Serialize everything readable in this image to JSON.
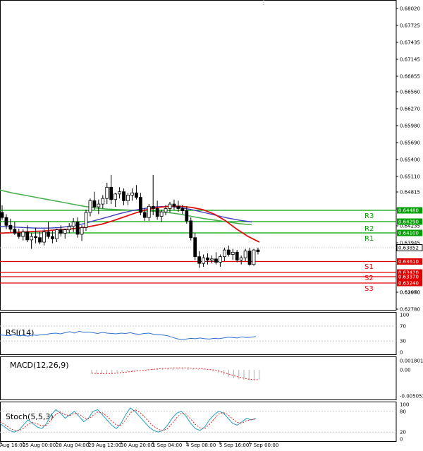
{
  "chart_data": {
    "type": "candlestick",
    "main": {
      "y_ticks": [
        "0.68020",
        "0.67725",
        "0.67435",
        "0.67145",
        "0.66855",
        "0.66560",
        "0.66270",
        "0.65980",
        "0.65690",
        "0.65400",
        "0.65110",
        "0.64815",
        "0.64525",
        "0.64235",
        "0.63945",
        "0.63610",
        "0.63250",
        "0.62960",
        "0.62780",
        "0.63070"
      ],
      "levels": [
        {
          "name": "R3",
          "value": 0.6448,
          "tag": "0.64480",
          "color": "#00a000"
        },
        {
          "name": "R2",
          "value": 0.6429,
          "tag": "0.64290",
          "color": "#00a000"
        },
        {
          "name": "R1",
          "value": 0.641,
          "tag": "0.64100",
          "color": "#00a000"
        },
        {
          "name": "S1",
          "value": 0.6342,
          "tag": "0.63420",
          "color": "#e00000"
        },
        {
          "name": "S2",
          "value": 0.6337,
          "tag": "0.63370",
          "color": "#e00000"
        },
        {
          "name": "S3",
          "value": 0.6324,
          "tag": "0.63240",
          "color": "#e00000"
        }
      ],
      "pivot": {
        "value": 0.6361,
        "tag": "0.63610",
        "color": "#e00000"
      },
      "current": {
        "value": 0.63852,
        "tag": "0.63852"
      },
      "candles": [
        [
          0.6455,
          0.6468,
          0.6442,
          0.6446
        ],
        [
          0.6446,
          0.6452,
          0.6425,
          0.6432
        ],
        [
          0.6432,
          0.6444,
          0.642,
          0.6425
        ],
        [
          0.6425,
          0.6438,
          0.6415,
          0.6418
        ],
        [
          0.6418,
          0.6426,
          0.6408,
          0.6412
        ],
        [
          0.6412,
          0.6425,
          0.6405,
          0.642
        ],
        [
          0.642,
          0.6432,
          0.6402,
          0.6406
        ],
        [
          0.6406,
          0.6418,
          0.639,
          0.6412
        ],
        [
          0.6412,
          0.6428,
          0.64,
          0.641
        ],
        [
          0.641,
          0.642,
          0.6398,
          0.6402
        ],
        [
          0.6402,
          0.6425,
          0.6396,
          0.642
        ],
        [
          0.642,
          0.6438,
          0.6408,
          0.6412
        ],
        [
          0.6412,
          0.6422,
          0.64,
          0.6408
        ],
        [
          0.6408,
          0.6426,
          0.6402,
          0.6424
        ],
        [
          0.6424,
          0.6432,
          0.6412,
          0.6418
        ],
        [
          0.6418,
          0.6426,
          0.6408,
          0.6424
        ],
        [
          0.6424,
          0.6436,
          0.6418,
          0.643
        ],
        [
          0.643,
          0.6445,
          0.642,
          0.6438
        ],
        [
          0.6438,
          0.6446,
          0.641,
          0.6416
        ],
        [
          0.6416,
          0.6432,
          0.6404,
          0.6428
        ],
        [
          0.6428,
          0.646,
          0.6422,
          0.6455
        ],
        [
          0.6455,
          0.648,
          0.6448,
          0.6476
        ],
        [
          0.6476,
          0.6492,
          0.646,
          0.6465
        ],
        [
          0.6465,
          0.6478,
          0.6452,
          0.647
        ],
        [
          0.647,
          0.6486,
          0.6462,
          0.648
        ],
        [
          0.648,
          0.6508,
          0.647,
          0.65
        ],
        [
          0.65,
          0.6522,
          0.647,
          0.6478
        ],
        [
          0.6478,
          0.649,
          0.6465,
          0.6488
        ],
        [
          0.6488,
          0.65,
          0.648,
          0.6492
        ],
        [
          0.6492,
          0.6498,
          0.6468,
          0.6476
        ],
        [
          0.6476,
          0.649,
          0.6468,
          0.6486
        ],
        [
          0.6486,
          0.6498,
          0.6476,
          0.649
        ],
        [
          0.649,
          0.6504,
          0.6478,
          0.6482
        ],
        [
          0.6482,
          0.649,
          0.645,
          0.6455
        ],
        [
          0.6455,
          0.6462,
          0.644,
          0.6446
        ],
        [
          0.6446,
          0.647,
          0.644,
          0.6466
        ],
        [
          0.6466,
          0.6522,
          0.645,
          0.6462
        ],
        [
          0.6462,
          0.6476,
          0.6442,
          0.6448
        ],
        [
          0.6448,
          0.646,
          0.6438,
          0.6456
        ],
        [
          0.6456,
          0.6468,
          0.645,
          0.6462
        ],
        [
          0.6462,
          0.6474,
          0.6455,
          0.647
        ],
        [
          0.647,
          0.6478,
          0.646,
          0.6466
        ],
        [
          0.6466,
          0.6476,
          0.6456,
          0.6462
        ],
        [
          0.6462,
          0.6468,
          0.6452,
          0.6458
        ],
        [
          0.6458,
          0.6466,
          0.6435,
          0.644
        ],
        [
          0.644,
          0.6446,
          0.6405,
          0.641
        ],
        [
          0.641,
          0.6418,
          0.637,
          0.6376
        ],
        [
          0.6376,
          0.6386,
          0.6356,
          0.6364
        ],
        [
          0.6364,
          0.638,
          0.6358,
          0.6374
        ],
        [
          0.6374,
          0.6382,
          0.6362,
          0.637
        ],
        [
          0.637,
          0.6378,
          0.6364,
          0.6372
        ],
        [
          0.6372,
          0.6384,
          0.6362,
          0.6366
        ],
        [
          0.6366,
          0.638,
          0.6358,
          0.6376
        ],
        [
          0.6376,
          0.6392,
          0.6368,
          0.6388
        ],
        [
          0.6388,
          0.6396,
          0.6376,
          0.638
        ],
        [
          0.638,
          0.639,
          0.637,
          0.6384
        ],
        [
          0.6384,
          0.6388,
          0.6366,
          0.637
        ],
        [
          0.637,
          0.6378,
          0.6362,
          0.6374
        ],
        [
          0.6374,
          0.639,
          0.6368,
          0.6386
        ],
        [
          0.6386,
          0.6392,
          0.636,
          0.6362
        ],
        [
          0.6362,
          0.639,
          0.636,
          0.6388
        ],
        [
          0.6388,
          0.6392,
          0.638,
          0.6385
        ]
      ],
      "ma_red": [
        0.6418,
        0.6419,
        0.642,
        0.6421,
        0.6422,
        0.6424,
        0.6425,
        0.6427,
        0.643,
        0.6434,
        0.644,
        0.6447,
        0.6454,
        0.646,
        0.6464,
        0.6466,
        0.6466,
        0.6464,
        0.646,
        0.6452,
        0.644,
        0.6425,
        0.6412,
        0.6402
      ],
      "ma_blue": [
        0.643,
        0.6429,
        0.6428,
        0.6427,
        0.6427,
        0.6428,
        0.6431,
        0.6435,
        0.6441,
        0.6447,
        0.6453,
        0.6458,
        0.6462,
        0.6465,
        0.6466,
        0.6464,
        0.646,
        0.6455,
        0.645,
        0.6445,
        0.6441,
        0.6438
      ],
      "ma_green": [
        0.6495,
        0.649,
        0.6486,
        0.6482,
        0.6478,
        0.6474,
        0.647,
        0.6466,
        0.6463,
        0.6461,
        0.646,
        0.6459,
        0.6458,
        0.6457,
        0.6455,
        0.6452,
        0.6448,
        0.6444,
        0.6441,
        0.6438,
        0.6435,
        0.6433
      ]
    },
    "rsi": {
      "title": "RSI(14)",
      "ticks": [
        "100",
        "70",
        "30",
        "0"
      ],
      "values": [
        46,
        45,
        44,
        47,
        44,
        45,
        43,
        46,
        45,
        47,
        48,
        50,
        51,
        49,
        52,
        55,
        51,
        56,
        53,
        54,
        52,
        50,
        53,
        51,
        50,
        49,
        51,
        50,
        52,
        49,
        48,
        50,
        51,
        48,
        47,
        46,
        44,
        40,
        36,
        34,
        35,
        37,
        36,
        38,
        36,
        35,
        37,
        36,
        38,
        40,
        39,
        38,
        41,
        39,
        40,
        42
      ]
    },
    "macd": {
      "title": "MACD(12,26,9)",
      "ticks": [
        "0.001801",
        "0.00",
        "-0.005053"
      ],
      "bars": [
        -0.0007,
        -0.0008,
        -0.0008,
        -0.0007,
        -0.0006,
        -0.0005,
        -0.0004,
        -0.0003,
        -0.0002,
        -0.0001,
        0.0,
        0.0001,
        0.0002,
        0.0003,
        0.0003,
        0.0004,
        0.0004,
        0.0004,
        0.0004,
        0.0003,
        0.0003,
        0.0002,
        0.0001,
        0.0,
        -0.0002,
        -0.0006,
        -0.001,
        -0.0013,
        -0.0016,
        -0.0018,
        -0.0019,
        -0.002,
        -0.002,
        -0.0019
      ],
      "signal": [
        -0.0006,
        -0.0007,
        -0.0007,
        -0.0007,
        -0.0007,
        -0.0006,
        -0.0005,
        -0.0004,
        -0.0003,
        -0.0002,
        -0.0001,
        0.0,
        0.0001,
        0.0002,
        0.0003,
        0.0003,
        0.0004,
        0.0004,
        0.0004,
        0.0004,
        0.0003,
        0.0003,
        0.0002,
        0.0001,
        0.0,
        -0.0002,
        -0.0005,
        -0.0008,
        -0.0011,
        -0.0014,
        -0.0016,
        -0.0018,
        -0.0019,
        -0.0019
      ]
    },
    "stoch": {
      "title": "Stoch(5,5,3)",
      "ticks": [
        "100",
        "80",
        "20",
        "0"
      ],
      "main": [
        45,
        35,
        25,
        20,
        25,
        40,
        55,
        45,
        35,
        30,
        45,
        70,
        85,
        75,
        60,
        70,
        80,
        65,
        50,
        60,
        80,
        85,
        70,
        55,
        40,
        30,
        45,
        70,
        90,
        80,
        65,
        50,
        35,
        25,
        20,
        25,
        40,
        60,
        75,
        80,
        65,
        45,
        30,
        25,
        35,
        55,
        70,
        80,
        75,
        60,
        45,
        40,
        50,
        60,
        55,
        60
      ],
      "signal": [
        50,
        42,
        32,
        25,
        24,
        30,
        42,
        48,
        44,
        38,
        40,
        55,
        72,
        78,
        70,
        68,
        74,
        72,
        62,
        58,
        68,
        78,
        76,
        65,
        52,
        40,
        40,
        55,
        75,
        85,
        78,
        65,
        50,
        37,
        28,
        24,
        30,
        45,
        62,
        75,
        72,
        58,
        42,
        32,
        30,
        42,
        58,
        72,
        77,
        70,
        58,
        48,
        46,
        53,
        56,
        58
      ]
    },
    "x_labels": [
      "Aug 16:00",
      "25 Aug 00:00",
      "28 Aug 04:00",
      "29 Aug 12:00",
      "30 Aug 20:00",
      "1 Sep 04:00",
      "4 Sep 08:00",
      "5 Sep 16:00",
      "7 Sep 00:00"
    ]
  }
}
